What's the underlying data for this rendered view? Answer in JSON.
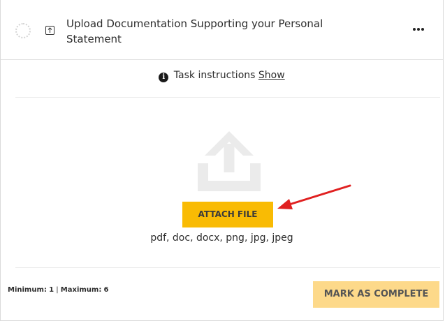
{
  "task": {
    "title": "Upload Documentation Supporting your Personal Statement"
  },
  "instructions": {
    "label": "Task instructions",
    "link": "Show"
  },
  "upload": {
    "attach_label": "ATTACH FILE",
    "file_types": "pdf, doc, docx, png, jpg, jpeg"
  },
  "footer": {
    "minimum_label": "Minimum:",
    "minimum_value": "1",
    "separator": "|",
    "maximum_label": "Maximum:",
    "maximum_value": "6",
    "mark_complete_label": "MARK AS COMPLETE"
  },
  "colors": {
    "primary_button": "#f9bb04",
    "disabled_button": "#fdd98a",
    "annotation_arrow": "#e02020"
  },
  "icons": {
    "status": "dotted-circle-icon",
    "task_type": "upload-box-icon",
    "menu": "ellipsis-icon",
    "info": "info-icon",
    "illustration": "upload-tray-icon",
    "annotation": "red-arrow-icon"
  }
}
